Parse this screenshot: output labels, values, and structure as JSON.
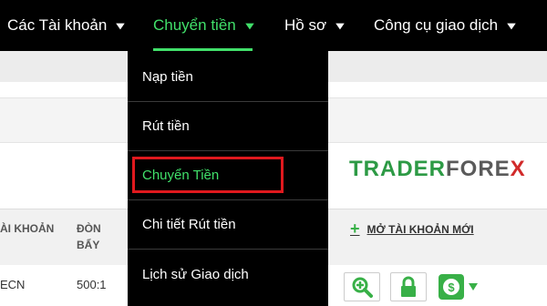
{
  "nav": {
    "items": [
      {
        "label": "Các Tài khoản"
      },
      {
        "label": "Chuyển tiền"
      },
      {
        "label": "Hồ sơ"
      },
      {
        "label": "Công cụ giao dịch"
      }
    ],
    "chevron": "▾"
  },
  "dropdown": {
    "items": [
      {
        "label": "Nạp tiền"
      },
      {
        "label": "Rút tiền"
      },
      {
        "label": "Chuyển Tiền"
      },
      {
        "label": "Chi tiết Rút tiền"
      },
      {
        "label": "Lịch sử Giao dịch"
      }
    ],
    "highlighted_index": 2,
    "highlight_color": "#e0191e"
  },
  "logo": {
    "part_trader": "TRADER",
    "part_fore": "FORE",
    "part_x": "X"
  },
  "table": {
    "headers": {
      "account": "ÀI KHOẢN",
      "leverage": "ĐÒN BẨY"
    },
    "open_account_plus": "+",
    "open_account_link": "MỞ TÀI KHOẢN MỚI",
    "rows": [
      {
        "account": "ECN",
        "leverage": "500:1"
      }
    ],
    "row_icons": [
      "zoom-in-icon",
      "lock-icon",
      "money-transfer-icon"
    ]
  },
  "colors": {
    "accent": "#41e06a",
    "brand_green": "#38b047",
    "logo_gray": "#5a5a5a",
    "logo_red": "#d12a2a",
    "nav_bg": "#000000"
  }
}
